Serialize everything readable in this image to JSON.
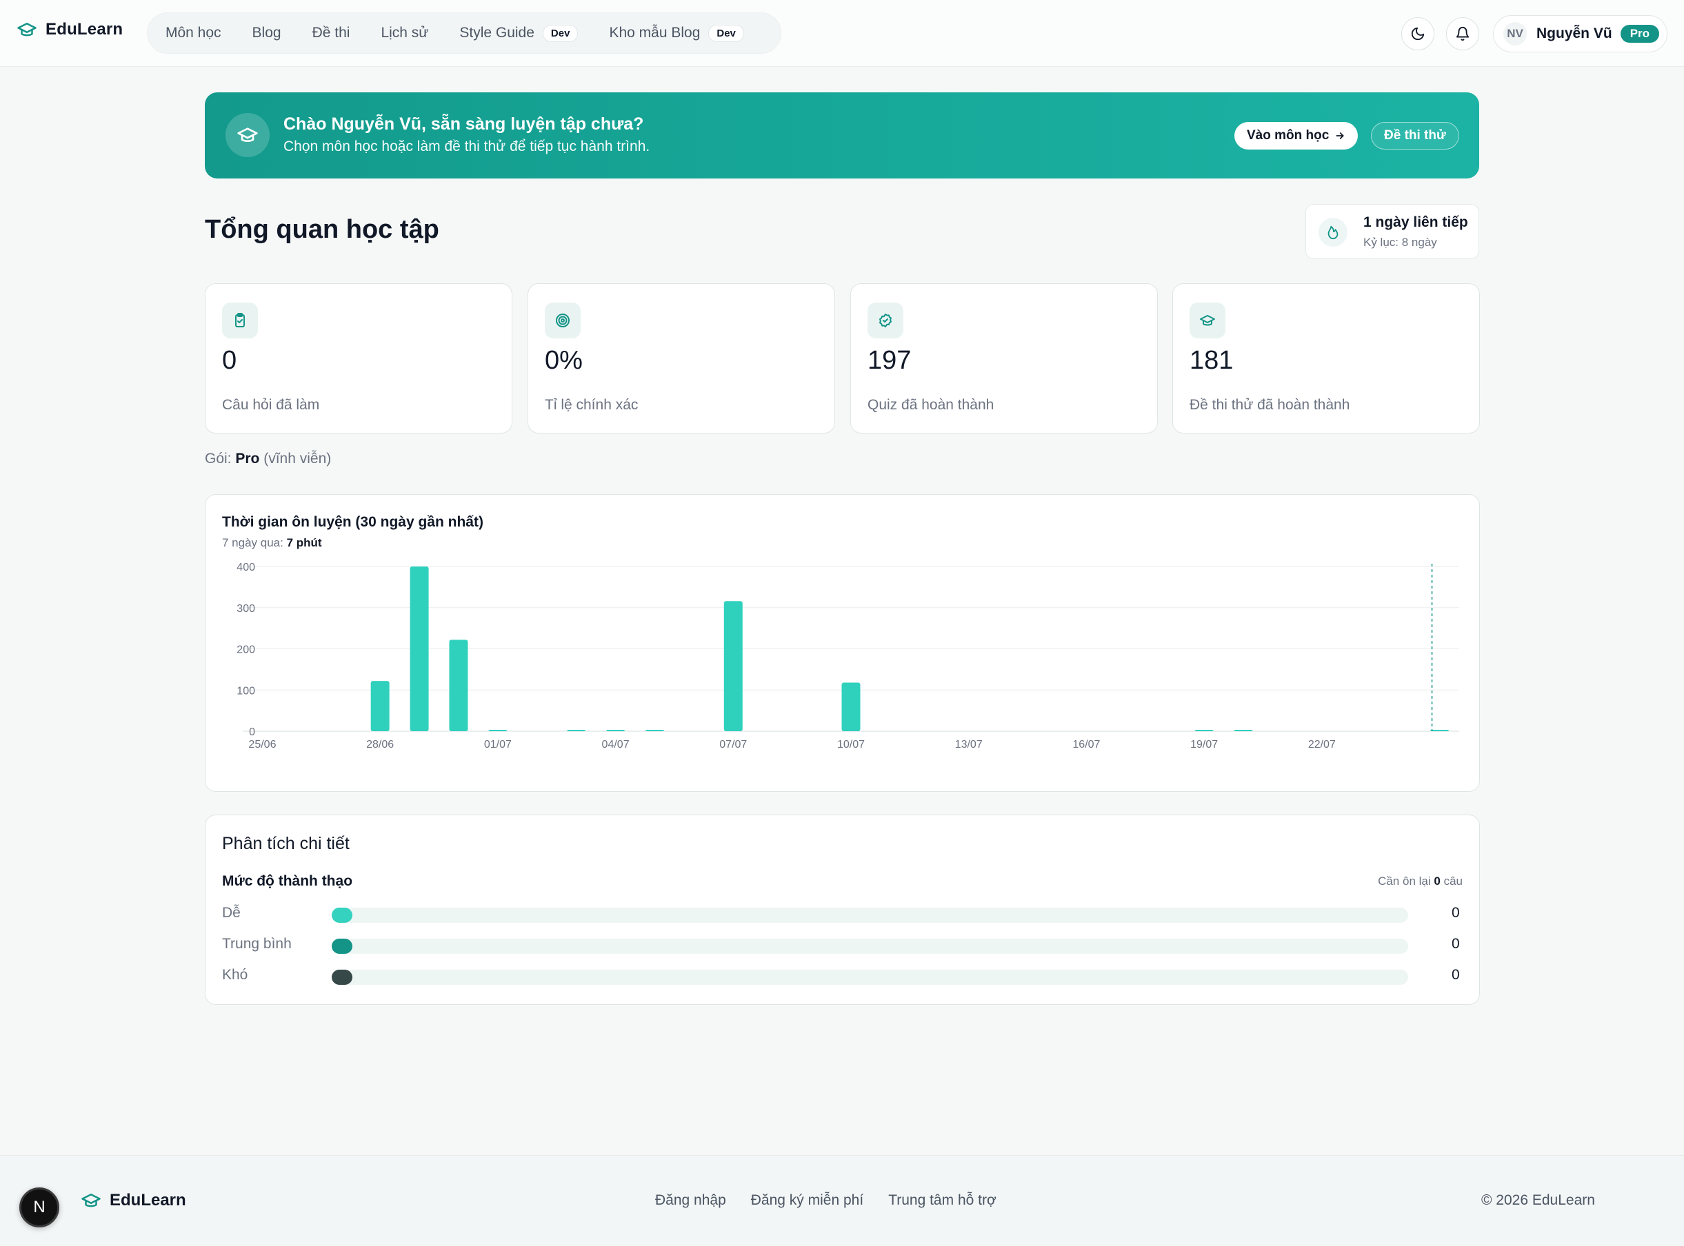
{
  "header": {
    "brand": "EduLearn",
    "nav": [
      {
        "label": "Môn học"
      },
      {
        "label": "Blog"
      },
      {
        "label": "Đề thi"
      },
      {
        "label": "Lịch sử"
      },
      {
        "label": "Style Guide",
        "badge": "Dev"
      },
      {
        "label": "Kho mẫu Blog",
        "badge": "Dev"
      }
    ],
    "theme_icon": "moon-icon",
    "notification_icon": "bell-icon",
    "user": {
      "initials": "NV",
      "name": "Nguyễn Vũ",
      "plan_badge": "Pro"
    }
  },
  "banner": {
    "title": "Chào Nguyễn Vũ, sẵn sàng luyện tập chưa?",
    "subtitle": "Chọn môn học hoặc làm đề thi thử để tiếp tục hành trình.",
    "primary_button": "Vào môn học",
    "secondary_button": "Đề thi thử"
  },
  "overview": {
    "title": "Tổng quan học tập",
    "streak": {
      "main": "1 ngày liên tiếp",
      "sub": "Kỷ lục: 8 ngày"
    },
    "stats": [
      {
        "icon": "clipboard-check-icon",
        "value": "0",
        "label": "Câu hỏi đã làm"
      },
      {
        "icon": "target-icon",
        "value": "0%",
        "label": "Tỉ lệ chính xác"
      },
      {
        "icon": "badge-check-icon",
        "value": "197",
        "label": "Quiz đã hoàn thành"
      },
      {
        "icon": "graduation-cap-icon",
        "value": "181",
        "label": "Đề thi thử đã hoàn thành"
      }
    ],
    "plan": {
      "prefix": "Gói:",
      "name": "Pro",
      "suffix": "(vĩnh viễn)"
    }
  },
  "chart_data": {
    "type": "bar",
    "title": "Thời gian ôn luyện (30 ngày gần nhất)",
    "subtitle_prefix": "7 ngày qua:",
    "subtitle_value": "7 phút",
    "categories": [
      "25/06",
      "26/06",
      "27/06",
      "28/06",
      "29/06",
      "30/06",
      "01/07",
      "02/07",
      "03/07",
      "04/07",
      "05/07",
      "06/07",
      "07/07",
      "08/07",
      "09/07",
      "10/07",
      "11/07",
      "12/07",
      "13/07",
      "14/07",
      "15/07",
      "16/07",
      "17/07",
      "18/07",
      "19/07",
      "20/07",
      "21/07",
      "22/07",
      "23/07",
      "24/07",
      "25/07"
    ],
    "tick_labels": [
      "25/06",
      "28/06",
      "01/07",
      "04/07",
      "07/07",
      "10/07",
      "13/07",
      "16/07",
      "19/07",
      "22/07"
    ],
    "values": [
      0,
      0,
      0,
      122,
      400,
      222,
      2,
      0,
      2,
      3,
      2,
      0,
      316,
      0,
      0,
      118,
      0,
      0,
      0,
      0,
      0,
      0,
      0,
      0,
      2,
      1,
      0,
      0,
      0,
      0,
      3
    ],
    "yticks": [
      0,
      100,
      200,
      300,
      400
    ],
    "ylim": [
      0,
      400
    ],
    "bar_color": "#2fd1bd",
    "grid": true,
    "highlight_category": "25/07"
  },
  "analysis": {
    "title": "Phân tích chi tiết",
    "mastery_title": "Mức độ thành thạo",
    "review_prefix": "Cần ôn lại",
    "review_count": "0",
    "review_suffix": "câu",
    "levels": [
      {
        "label": "Dễ",
        "count": "0",
        "color": "#34d2bf"
      },
      {
        "label": "Trung bình",
        "count": "0",
        "color": "#139487"
      },
      {
        "label": "Khó",
        "count": "0",
        "color": "#374849"
      }
    ]
  },
  "footer": {
    "brand": "EduLearn",
    "links": [
      "Đăng nhập",
      "Đăng ký miễn phí",
      "Trung tâm hỗ trợ"
    ],
    "copyright": "© 2026 EduLearn",
    "dev_badge": "N"
  }
}
